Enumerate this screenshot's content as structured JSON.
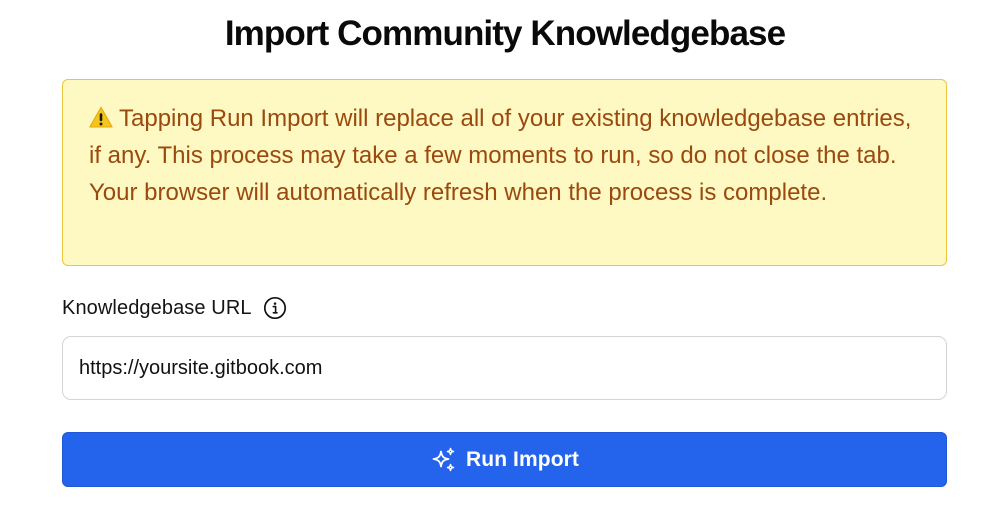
{
  "page": {
    "title": "Import Community Knowledgebase"
  },
  "warning": {
    "icon": "warning-triangle-icon",
    "text": "Tapping Run Import will replace all of your existing knowledgebase entries, if any. This process may take a few moments to run, so do not close the tab. Your browser will automatically refresh when the process is complete.",
    "background_color": "#fef8c3",
    "border_color": "#ecc63c",
    "text_color": "#9a4a0e"
  },
  "form": {
    "url_label": "Knowledgebase URL",
    "url_info_icon": "info-circle-icon",
    "url_value": "https://yoursite.gitbook.com",
    "url_placeholder": ""
  },
  "actions": {
    "run_import_label": "Run Import",
    "run_import_icon": "sparkles-icon",
    "accent_color": "#2463eb"
  }
}
